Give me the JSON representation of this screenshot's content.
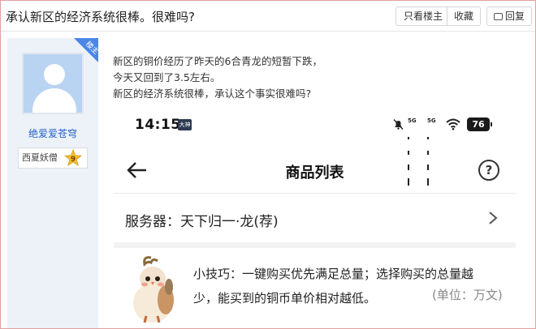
{
  "thread": {
    "title": "承认新区的经济系统很棒。很难吗?",
    "buttons": {
      "only_op": "只看楼主",
      "favorite": "收藏",
      "reply": "回复"
    }
  },
  "author": {
    "op_badge": "楼主",
    "username": "绝爱爱苍穹",
    "rank_title": "西夏妖僧",
    "level": "9"
  },
  "post": {
    "lines": [
      "新区的铜价经历了昨天的6合青龙的短暂下跌，",
      "今天又回到了3.5左右。",
      "新区的经济系统很棒，承认这个事实很难吗?"
    ]
  },
  "screenshot": {
    "time": "14:15",
    "hd_badge": "大神",
    "signal1_label": "5G",
    "signal2_label": "5G",
    "battery": "76",
    "page_title": "商品列表",
    "help_glyph": "?",
    "server_label": "服务器：天下归一·龙(荐)",
    "tip_line1": "小技巧：一键购买优先满足总量；选择购买的总量越",
    "tip_line2": "少，能买到的铜币单价相对越低。",
    "unit_label": "(单位：万文)"
  }
}
